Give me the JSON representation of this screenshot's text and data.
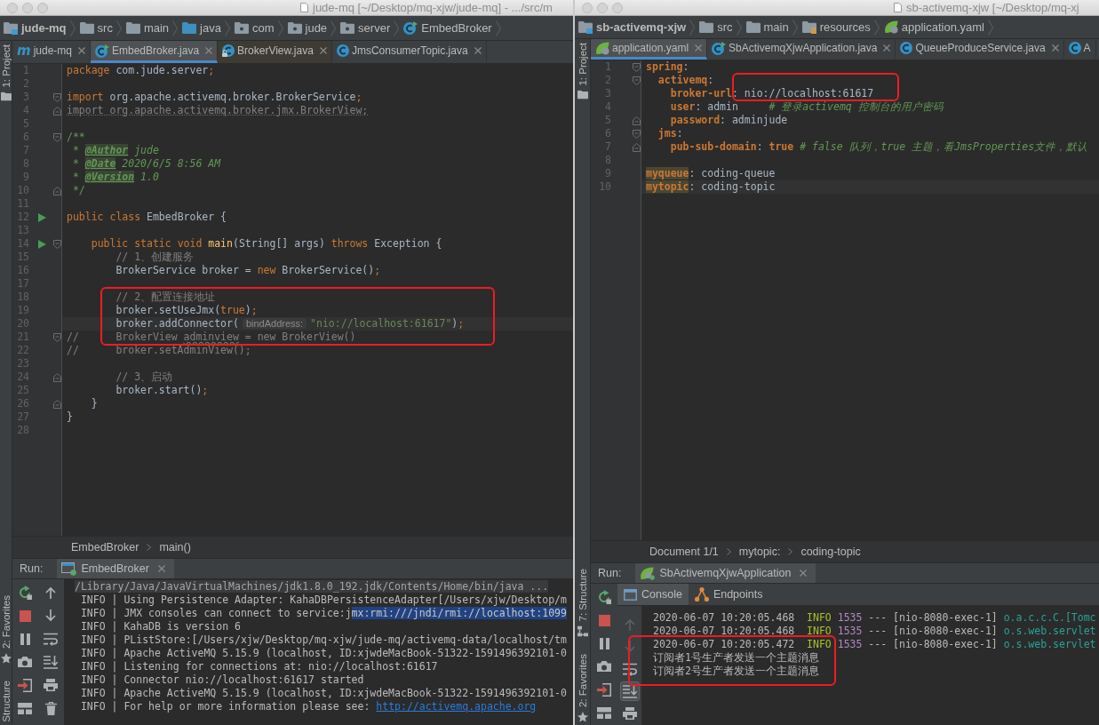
{
  "windows": [
    {
      "title": "jude-mq [~/Desktop/mq-xjw/jude-mq] - .../src/m",
      "navigation": [
        {
          "label": "jude-mq",
          "kind": "module"
        },
        {
          "label": "src",
          "kind": "folder"
        },
        {
          "label": "main",
          "kind": "folder"
        },
        {
          "label": "java",
          "kind": "source-root"
        },
        {
          "label": "com",
          "kind": "package"
        },
        {
          "label": "jude",
          "kind": "package"
        },
        {
          "label": "server",
          "kind": "package"
        },
        {
          "label": "EmbedBroker",
          "kind": "runnable-class"
        }
      ],
      "tool_strip": {
        "top": [
          {
            "label": "1: Project",
            "kind": "project"
          }
        ],
        "bottom": [
          {
            "label": "2: Favorites",
            "kind": "favorites"
          },
          {
            "label": "Structure",
            "kind": "text"
          }
        ]
      },
      "tabs": [
        {
          "label": "jude-mq",
          "kind": "maven",
          "glyph": "m",
          "selected": false,
          "close_button": true
        },
        {
          "label": "EmbedBroker.java",
          "kind": "runnable-class",
          "selected": true,
          "close_button": true
        },
        {
          "label": "BrokerView.java",
          "kind": "library-class",
          "selected": false,
          "close_button": true
        },
        {
          "label": "JmsConsumerTopic.java",
          "kind": "class",
          "selected": false,
          "close_button": true
        }
      ],
      "editor": {
        "kind": "java",
        "lines": [
          {
            "number": "1",
            "current": false,
            "framed": false,
            "tokens": [
              {
                "text": "package",
                "kind": "keyword"
              },
              {
                "text": " com.jude.server",
                "kind": "plain"
              },
              {
                "text": ";",
                "kind": "keyword"
              }
            ]
          },
          {
            "number": "2",
            "current": false,
            "framed": false
          },
          {
            "number": "3",
            "current": false,
            "framed": false,
            "markers": [
              {
                "kind": "fold-start"
              }
            ],
            "tokens": [
              {
                "text": "import",
                "kind": "keyword"
              },
              {
                "text": " org.apache.activemq.broker.BrokerService",
                "kind": "plain"
              },
              {
                "text": ";",
                "kind": "keyword"
              }
            ]
          },
          {
            "number": "4",
            "current": false,
            "framed": false,
            "markers": [
              {
                "kind": "fold-end"
              }
            ],
            "tokens": [
              {
                "text": "import org.apache.activemq.broker.jmx.BrokerView;",
                "kind": "unused"
              }
            ]
          },
          {
            "number": "5",
            "current": false,
            "framed": false
          },
          {
            "number": "6",
            "current": false,
            "framed": false,
            "markers": [
              {
                "kind": "fold-start"
              }
            ],
            "tokens": [
              {
                "text": "/**",
                "kind": "doc"
              }
            ]
          },
          {
            "number": "7",
            "current": false,
            "framed": false,
            "tokens": [
              {
                "text": " * ",
                "kind": "doc"
              },
              {
                "text": "@Author",
                "kind": "doc-tag"
              },
              {
                "text": " jude",
                "kind": "doc-text"
              }
            ]
          },
          {
            "number": "8",
            "current": false,
            "framed": false,
            "tokens": [
              {
                "text": " * ",
                "kind": "doc"
              },
              {
                "text": "@Date",
                "kind": "doc-tag"
              },
              {
                "text": " 2020/6/5 8:56 AM",
                "kind": "doc-text"
              }
            ]
          },
          {
            "number": "9",
            "current": false,
            "framed": false,
            "tokens": [
              {
                "text": " * ",
                "kind": "doc"
              },
              {
                "text": "@Version",
                "kind": "doc-tag"
              },
              {
                "text": " 1.0",
                "kind": "doc-text"
              }
            ]
          },
          {
            "number": "10",
            "current": false,
            "framed": false,
            "markers": [
              {
                "kind": "fold-end"
              }
            ],
            "tokens": [
              {
                "text": " */",
                "kind": "doc"
              }
            ]
          },
          {
            "number": "11",
            "current": false,
            "framed": false
          },
          {
            "number": "12",
            "current": false,
            "framed": false,
            "markers": [
              {
                "kind": "run"
              }
            ],
            "tokens": [
              {
                "text": "public class",
                "kind": "keyword"
              },
              {
                "text": " EmbedBroker {",
                "kind": "plain"
              }
            ]
          },
          {
            "number": "13",
            "current": false,
            "framed": false
          },
          {
            "number": "14",
            "current": false,
            "framed": false,
            "markers": [
              {
                "kind": "run"
              },
              {
                "kind": "fold-start"
              }
            ],
            "tokens": [
              {
                "text": "    public static void ",
                "kind": "keyword"
              },
              {
                "text": "main",
                "kind": "method"
              },
              {
                "text": "(String[] args) ",
                "kind": "plain"
              },
              {
                "text": "throws",
                "kind": "keyword"
              },
              {
                "text": " Exception {",
                "kind": "plain"
              }
            ]
          },
          {
            "number": "15",
            "current": false,
            "framed": false,
            "tokens": [
              {
                "text": "        // 1、创建服务",
                "kind": "comment"
              }
            ]
          },
          {
            "number": "16",
            "current": false,
            "framed": false,
            "tokens": [
              {
                "text": "        BrokerService broker = ",
                "kind": "plain"
              },
              {
                "text": "new",
                "kind": "keyword"
              },
              {
                "text": " BrokerService()",
                "kind": "plain"
              },
              {
                "text": ";",
                "kind": "keyword"
              }
            ]
          },
          {
            "number": "17",
            "current": false,
            "framed": false
          },
          {
            "number": "18",
            "current": false,
            "framed": true,
            "tokens": [
              {
                "text": "        // 2、配置连接地址",
                "kind": "comment"
              }
            ]
          },
          {
            "number": "19",
            "current": false,
            "framed": true,
            "tokens": [
              {
                "text": "        broker.setUseJmx(",
                "kind": "plain"
              },
              {
                "text": "true",
                "kind": "keyword"
              },
              {
                "text": ")",
                "kind": "plain"
              },
              {
                "text": ";",
                "kind": "keyword"
              }
            ]
          },
          {
            "number": "20",
            "current": true,
            "framed": true,
            "tokens": [
              {
                "text": "        broker.addConnector(",
                "kind": "plain"
              },
              {
                "text": "bindAddress:",
                "kind": "hint"
              },
              {
                "text": "\"nio://localhost:61617\"",
                "kind": "string"
              },
              {
                "text": ")",
                "kind": "plain"
              },
              {
                "text": ";",
                "kind": "keyword"
              }
            ]
          },
          {
            "number": "21",
            "current": false,
            "framed": true,
            "markers": [
              {
                "kind": "fold-start"
              }
            ],
            "tokens": [
              {
                "text": "//      BrokerView ",
                "kind": "comment"
              },
              {
                "text": "adminview",
                "kind": "typo"
              },
              {
                "text": " = new BrokerView()",
                "kind": "comment"
              }
            ]
          },
          {
            "number": "22",
            "current": false,
            "framed": false,
            "tokens": [
              {
                "text": "//      broker.setAdminView();",
                "kind": "comment"
              }
            ]
          },
          {
            "number": "23",
            "current": false,
            "framed": false
          },
          {
            "number": "24",
            "current": false,
            "framed": false,
            "markers": [
              {
                "kind": "fold-end"
              }
            ],
            "tokens": [
              {
                "text": "        // 3、启动",
                "kind": "comment"
              }
            ]
          },
          {
            "number": "25",
            "current": false,
            "framed": false,
            "tokens": [
              {
                "text": "        broker.start()",
                "kind": "plain"
              },
              {
                "text": ";",
                "kind": "keyword"
              }
            ]
          },
          {
            "number": "26",
            "current": false,
            "framed": false,
            "markers": [
              {
                "kind": "fold-end"
              }
            ],
            "tokens": [
              {
                "text": "    }",
                "kind": "plain"
              }
            ]
          },
          {
            "number": "27",
            "current": false,
            "framed": false,
            "tokens": [
              {
                "text": "}",
                "kind": "plain"
              }
            ]
          },
          {
            "number": "28",
            "current": false,
            "framed": false
          }
        ]
      },
      "breadcrumbs": [
        "EmbedBroker",
        "main()"
      ],
      "run": {
        "title": "Run:",
        "tab": {
          "label": "EmbedBroker",
          "kind": "application"
        },
        "toolbar": [
          {
            "kind": "rerun"
          },
          {
            "kind": "stop"
          },
          {
            "kind": "pause"
          },
          {
            "kind": "camera"
          },
          {
            "kind": "exit"
          },
          {
            "kind": "layout"
          }
        ],
        "console_toolbar": [
          {
            "kind": "up",
            "disabled": false,
            "on": false
          },
          {
            "kind": "down",
            "disabled": false,
            "on": false
          },
          {
            "kind": "wrap",
            "disabled": false,
            "on": false
          },
          {
            "kind": "scroll-end",
            "disabled": false,
            "on": false
          },
          {
            "kind": "print",
            "disabled": false,
            "on": false
          },
          {
            "kind": "trash",
            "disabled": false,
            "on": false
          }
        ],
        "console": {
          "lines": [
            {
              "tokens": [
                {
                  "text": "/Library/Java/JavaVirtualMachines/jdk1.8.0_192.jdk/Contents/Home/bin/java ...",
                  "kind": "command"
                }
              ]
            },
            {
              "tokens": [
                {
                  "text": " INFO | Using Persistence Adapter: KahaDBPersistenceAdapter[/Users/xjw/Desktop/m",
                  "kind": "plain"
                }
              ]
            },
            {
              "tokens": [
                {
                  "text": " INFO | JMX consoles can connect to service:j",
                  "kind": "plain"
                },
                {
                  "text": "mx:rmi:///jndi/rmi://localhost:1099",
                  "kind": "selection"
                }
              ]
            },
            {
              "tokens": [
                {
                  "text": " INFO | KahaDB is version 6",
                  "kind": "plain"
                }
              ]
            },
            {
              "tokens": [
                {
                  "text": " INFO | PListStore:[/Users/xjw/Desktop/mq-xjw/jude-mq/activemq-data/localhost/tm",
                  "kind": "plain"
                }
              ]
            },
            {
              "tokens": [
                {
                  "text": " INFO | Apache ActiveMQ 5.15.9 (localhost, ID:xjwdeMacBook-51322-1591496392101-0",
                  "kind": "plain"
                }
              ]
            },
            {
              "tokens": [
                {
                  "text": " INFO | Listening for connections at: nio://localhost:61617",
                  "kind": "plain"
                }
              ]
            },
            {
              "tokens": [
                {
                  "text": " INFO | Connector nio://localhost:61617 started",
                  "kind": "plain"
                }
              ]
            },
            {
              "tokens": [
                {
                  "text": " INFO | Apache ActiveMQ 5.15.9 (localhost, ID:xjwdeMacBook-51322-1591496392101-0",
                  "kind": "plain"
                }
              ]
            },
            {
              "tokens": [
                {
                  "text": " INFO | For help or more information please see: ",
                  "kind": "plain"
                },
                {
                  "text": "http://activemq.apache.org",
                  "kind": "link"
                }
              ]
            }
          ]
        }
      }
    },
    {
      "title": "sb-activemq-xjw [~/Desktop/mq-xj",
      "navigation": [
        {
          "label": "sb-activemq-xjw",
          "kind": "module"
        },
        {
          "label": "src",
          "kind": "folder"
        },
        {
          "label": "main",
          "kind": "folder"
        },
        {
          "label": "resources",
          "kind": "resources"
        },
        {
          "label": "application.yaml",
          "kind": "config"
        }
      ],
      "tool_strip": {
        "top": [
          {
            "label": "1: Project",
            "kind": "project"
          }
        ],
        "bottom": [
          {
            "label": "7: Structure",
            "kind": "structure"
          },
          {
            "label": "2: Favorites",
            "kind": "favorites"
          }
        ]
      },
      "tabs": [
        {
          "label": "application.yaml",
          "kind": "config",
          "selected": true,
          "close_button": true
        },
        {
          "label": "SbActivemqXjwApplication.java",
          "kind": "runnable-class",
          "selected": false,
          "close_button": true
        },
        {
          "label": "QueueProduceService.java",
          "kind": "class",
          "selected": false,
          "close_button": true
        },
        {
          "label": "A",
          "kind": "class",
          "selected": false,
          "close_button": false
        }
      ],
      "editor": {
        "kind": "yaml",
        "lines": [
          {
            "number": "1",
            "current": false,
            "framed": false,
            "markers": [
              {
                "kind": "fold-start"
              }
            ],
            "tokens": [
              {
                "text": "spring",
                "kind": "key"
              },
              {
                "text": ":",
                "kind": "plain"
              }
            ]
          },
          {
            "number": "2",
            "current": false,
            "framed": true,
            "markers": [
              {
                "kind": "fold-start"
              }
            ],
            "tokens": [
              {
                "text": "  activemq",
                "kind": "key"
              },
              {
                "text": ":",
                "kind": "plain"
              }
            ]
          },
          {
            "number": "3",
            "current": false,
            "framed": true,
            "tokens": [
              {
                "text": "    broker-url",
                "kind": "key"
              },
              {
                "text": ": nio://localhost:61617",
                "kind": "plain"
              }
            ]
          },
          {
            "number": "4",
            "current": false,
            "framed": false,
            "tokens": [
              {
                "text": "    user",
                "kind": "key"
              },
              {
                "text": ": admin     ",
                "kind": "plain"
              },
              {
                "text": "# 登录activemq 控制台的用户密码",
                "kind": "comment"
              }
            ]
          },
          {
            "number": "5",
            "current": false,
            "framed": false,
            "markers": [
              {
                "kind": "fold-end"
              }
            ],
            "tokens": [
              {
                "text": "    password",
                "kind": "key"
              },
              {
                "text": ": adminjude",
                "kind": "plain"
              }
            ]
          },
          {
            "number": "6",
            "current": false,
            "framed": false,
            "markers": [
              {
                "kind": "fold-start"
              }
            ],
            "tokens": [
              {
                "text": "  jms",
                "kind": "key"
              },
              {
                "text": ":",
                "kind": "plain"
              }
            ]
          },
          {
            "number": "7",
            "current": false,
            "framed": false,
            "markers": [
              {
                "kind": "fold-end"
              }
            ],
            "tokens": [
              {
                "text": "    pub-sub-domain",
                "kind": "key"
              },
              {
                "text": ": ",
                "kind": "plain"
              },
              {
                "text": "true",
                "kind": "bool"
              },
              {
                "text": " # false 队列，true 主题，看JmsProperties文件，默认",
                "kind": "comment"
              }
            ]
          },
          {
            "number": "8",
            "current": false,
            "framed": false
          },
          {
            "number": "9",
            "current": false,
            "framed": false,
            "tokens": [
              {
                "text": "myqueue",
                "kind": "key-marked"
              },
              {
                "text": ": coding-queue",
                "kind": "plain"
              }
            ]
          },
          {
            "number": "10",
            "current": true,
            "framed": false,
            "tokens": [
              {
                "text": "mytopic",
                "kind": "key-marked"
              },
              {
                "text": ": coding-topic",
                "kind": "plain"
              }
            ]
          }
        ]
      },
      "breadcrumbs": [
        "Document 1/1",
        "mytopic:",
        "coding-topic"
      ],
      "run": {
        "title": "Run:",
        "tab": {
          "label": "SbActivemqXjwApplication",
          "kind": "spring"
        },
        "toolbar": [
          {
            "kind": "rerun"
          },
          {
            "kind": "stop"
          },
          {
            "kind": "pause"
          },
          {
            "kind": "camera"
          },
          {
            "kind": "exit"
          },
          {
            "kind": "layout"
          }
        ],
        "subtabs": [
          {
            "label": "Console",
            "kind": "console",
            "selected": true
          },
          {
            "label": "Endpoints",
            "kind": "endpoints",
            "selected": false
          }
        ],
        "console_toolbar": [
          {
            "kind": "up",
            "disabled": true,
            "on": false
          },
          {
            "kind": "down",
            "disabled": true,
            "on": false
          },
          {
            "kind": "wrap",
            "disabled": false,
            "on": false
          },
          {
            "kind": "scroll-end",
            "disabled": false,
            "on": true
          },
          {
            "kind": "print",
            "disabled": false,
            "on": false
          }
        ],
        "console": {
          "lines": [
            {
              "framed": false,
              "tokens": [
                {
                  "text": "2020-06-07 10:20:05.468  ",
                  "kind": "plain"
                },
                {
                  "text": "INFO",
                  "kind": "info"
                },
                {
                  "text": " 1535",
                  "kind": "pid"
                },
                {
                  "text": " --- [nio-8080-exec-1] ",
                  "kind": "plain"
                },
                {
                  "text": "o.a.c.c.C.[Tomc",
                  "kind": "logger"
                }
              ]
            },
            {
              "framed": false,
              "tokens": [
                {
                  "text": "2020-06-07 10:20:05.468  ",
                  "kind": "plain"
                },
                {
                  "text": "INFO",
                  "kind": "info"
                },
                {
                  "text": " 1535",
                  "kind": "pid"
                },
                {
                  "text": " --- [nio-8080-exec-1] ",
                  "kind": "plain"
                },
                {
                  "text": "o.s.web.servlet",
                  "kind": "logger"
                }
              ]
            },
            {
              "framed": true,
              "tokens": [
                {
                  "text": "2020-06-07 10:20:05.472  ",
                  "kind": "plain"
                },
                {
                  "text": "INFO",
                  "kind": "info"
                },
                {
                  "text": " 1535",
                  "kind": "pid"
                },
                {
                  "text": " --- [nio-8080-exec-1] ",
                  "kind": "plain"
                },
                {
                  "text": "o.s.web.servlet",
                  "kind": "logger"
                }
              ]
            },
            {
              "framed": true,
              "tokens": [
                {
                  "text": "订阅者1号生产者发送一个主题消息",
                  "kind": "plain"
                }
              ]
            },
            {
              "framed": true,
              "tokens": [
                {
                  "text": "订阅者2号生产者发送一个主题消息",
                  "kind": "plain"
                }
              ]
            }
          ]
        }
      }
    }
  ]
}
